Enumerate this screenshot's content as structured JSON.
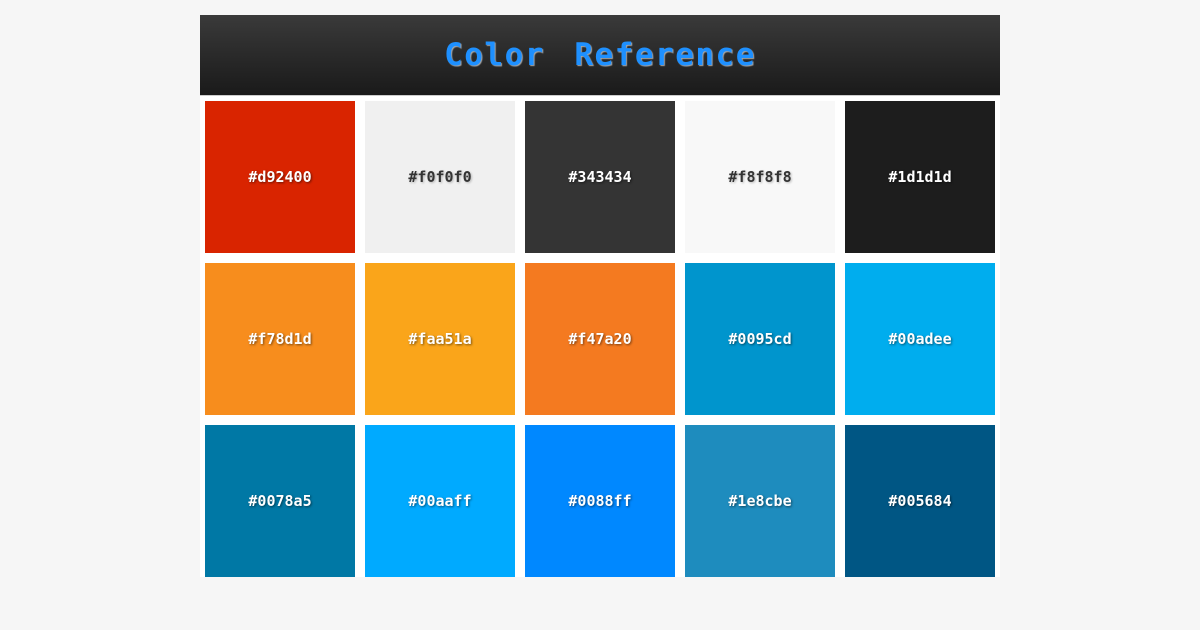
{
  "title": "Color Reference",
  "rows": [
    [
      {
        "hex": "#d92400",
        "dark": false
      },
      {
        "hex": "#f0f0f0",
        "dark": true
      },
      {
        "hex": "#343434",
        "dark": false
      },
      {
        "hex": "#f8f8f8",
        "dark": true
      },
      {
        "hex": "#1d1d1d",
        "dark": false
      }
    ],
    [
      {
        "hex": "#f78d1d",
        "dark": false
      },
      {
        "hex": "#faa51a",
        "dark": false
      },
      {
        "hex": "#f47a20",
        "dark": false
      },
      {
        "hex": "#0095cd",
        "dark": false
      },
      {
        "hex": "#00adee",
        "dark": false
      }
    ],
    [
      {
        "hex": "#0078a5",
        "dark": false
      },
      {
        "hex": "#00aaff",
        "dark": false
      },
      {
        "hex": "#0088ff",
        "dark": false
      },
      {
        "hex": "#1e8cbe",
        "dark": false
      },
      {
        "hex": "#005684",
        "dark": false
      }
    ]
  ]
}
